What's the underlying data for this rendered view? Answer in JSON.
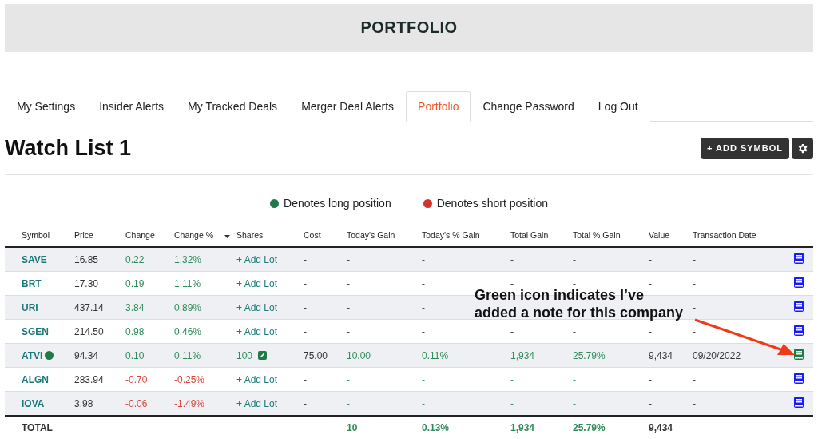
{
  "header": {
    "title": "PORTFOLIO"
  },
  "tabs": [
    {
      "label": "My Settings",
      "selected": false
    },
    {
      "label": "Insider Alerts",
      "selected": false
    },
    {
      "label": "My Tracked Deals",
      "selected": false
    },
    {
      "label": "Merger Deal Alerts",
      "selected": false
    },
    {
      "label": "Portfolio",
      "selected": true
    },
    {
      "label": "Change Password",
      "selected": false
    },
    {
      "label": "Log Out",
      "selected": false
    }
  ],
  "watchlist": {
    "title": "Watch List 1",
    "add_button": "+ ADD SYMBOL"
  },
  "legend": [
    {
      "label": "Denotes long position",
      "color": "#1e7a46"
    },
    {
      "label": "Denotes short position",
      "color": "#d0342c"
    }
  ],
  "table": {
    "columns": [
      "Symbol",
      "Price",
      "Change",
      "Change %",
      "Shares",
      "Cost",
      "Today's Gain",
      "Today's % Gain",
      "Total Gain",
      "Total % Gain",
      "Value",
      "Transaction Date"
    ],
    "rows": [
      {
        "symbol": "SAVE",
        "long": false,
        "price": "16.85",
        "change": "0.22",
        "change_pct": "1.32%",
        "falling": false,
        "shares": {
          "kind": "add",
          "label": "+ Add Lot"
        },
        "cost": "-",
        "todays_gain": "-",
        "todays_pct": "-",
        "total_gain": "-",
        "total_pct": "-",
        "gains_green": false,
        "value": "-",
        "date": "-",
        "has_note": false
      },
      {
        "symbol": "BRT",
        "long": false,
        "price": "17.30",
        "change": "0.19",
        "change_pct": "1.11%",
        "falling": false,
        "shares": {
          "kind": "add",
          "label": "+ Add Lot"
        },
        "cost": "-",
        "todays_gain": "-",
        "todays_pct": "-",
        "total_gain": "-",
        "total_pct": "-",
        "gains_green": false,
        "value": "-",
        "date": "-",
        "has_note": false
      },
      {
        "symbol": "URI",
        "long": false,
        "price": "437.14",
        "change": "3.84",
        "change_pct": "0.89%",
        "falling": false,
        "shares": {
          "kind": "add",
          "label": "+ Add Lot"
        },
        "cost": "-",
        "todays_gain": "-",
        "todays_pct": "-",
        "gains_green": false,
        "date": "-",
        "has_note": false
      },
      {
        "symbol": "SGEN",
        "long": false,
        "price": "214.50",
        "change": "0.98",
        "change_pct": "0.46%",
        "falling": false,
        "shares": {
          "kind": "add",
          "label": "+ Add Lot"
        },
        "cost": "-",
        "todays_gain": "-",
        "todays_pct": "-",
        "total_gain": "-",
        "total_pct": "-",
        "gains_green": false,
        "value": "-",
        "date": "-",
        "has_note": false
      },
      {
        "symbol": "ATVI",
        "long": true,
        "price": "94.34",
        "change": "0.10",
        "change_pct": "0.11%",
        "falling": false,
        "shares": {
          "kind": "lot",
          "label": "100"
        },
        "cost": "75.00",
        "todays_gain": "10.00",
        "todays_pct": "0.11%",
        "total_gain": "1,934",
        "total_pct": "25.79%",
        "gains_green": true,
        "value": "9,434",
        "date": "09/20/2022",
        "has_note": true
      },
      {
        "symbol": "ALGN",
        "long": false,
        "price": "283.94",
        "change": "-0.70",
        "change_pct": "-0.25%",
        "falling": true,
        "shares": {
          "kind": "add",
          "label": "+ Add Lot"
        },
        "cost": "-",
        "todays_gain": "-",
        "todays_pct": "-",
        "total_gain": "-",
        "total_pct": "-",
        "gains_green": true,
        "value": "-",
        "date": "-",
        "has_note": false
      },
      {
        "symbol": "IOVA",
        "long": false,
        "price": "3.98",
        "change": "-0.06",
        "change_pct": "-1.49%",
        "falling": true,
        "shares": {
          "kind": "add",
          "label": "+ Add Lot"
        },
        "cost": "-",
        "todays_gain": "-",
        "todays_pct": "-",
        "total_gain": "-",
        "total_pct": "-",
        "gains_green": true,
        "value": "-",
        "date": "-",
        "has_note": false
      }
    ],
    "total": {
      "label": "TOTAL",
      "todays_gain": "10",
      "todays_pct": "0.13%",
      "total_gain": "1,934",
      "total_pct": "25.79%",
      "value": "9,434"
    }
  },
  "annotation": {
    "text": "Green icon indicates I’ve added a note for this company"
  }
}
